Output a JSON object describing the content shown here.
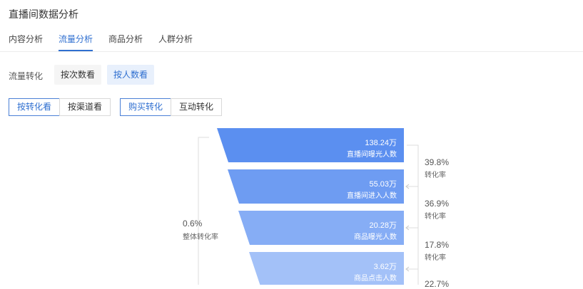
{
  "header": {
    "title": "直播间数据分析"
  },
  "tabs": [
    {
      "label": "内容分析"
    },
    {
      "label": "流量分析"
    },
    {
      "label": "商品分析"
    },
    {
      "label": "人群分析"
    }
  ],
  "sub": {
    "label": "流量转化",
    "options": [
      {
        "label": "按次数看"
      },
      {
        "label": "按人数看"
      }
    ]
  },
  "segment_a": [
    {
      "label": "按转化看"
    },
    {
      "label": "按渠道看"
    }
  ],
  "segment_b": [
    {
      "label": "购买转化"
    },
    {
      "label": "互动转化"
    }
  ],
  "funnel": {
    "overall": {
      "value": "0.6%",
      "label": "整体转化率"
    },
    "stages": [
      {
        "value": "138.24万",
        "label": "直播间曝光人数"
      },
      {
        "value": "55.03万",
        "label": "直播间进入人数"
      },
      {
        "value": "20.28万",
        "label": "商品曝光人数"
      },
      {
        "value": "3.62万",
        "label": "商品点击人数"
      }
    ],
    "rates": [
      {
        "value": "39.8%",
        "label": "转化率"
      },
      {
        "value": "36.9%",
        "label": "转化率"
      },
      {
        "value": "17.8%",
        "label": "转化率"
      },
      {
        "value": "22.7%",
        "label": ""
      }
    ]
  },
  "colors": {
    "accent": "#2f6fd0",
    "stage_fills": [
      "#5b8ff0",
      "#6e9cf2",
      "#86adf5",
      "#a3c1f8"
    ]
  }
}
